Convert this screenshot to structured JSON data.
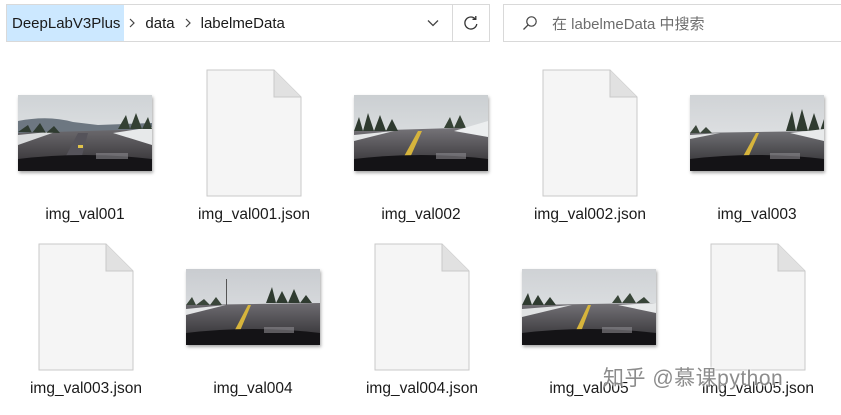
{
  "address": {
    "crumbs": [
      "DeepLabV3Plus",
      "data",
      "labelmeData"
    ]
  },
  "search": {
    "placeholder": "在 labelmeData 中搜索"
  },
  "files": [
    {
      "name": "img_val001",
      "kind": "image"
    },
    {
      "name": "img_val001.json",
      "kind": "json"
    },
    {
      "name": "img_val002",
      "kind": "image"
    },
    {
      "name": "img_val002.json",
      "kind": "json"
    },
    {
      "name": "img_val003",
      "kind": "image"
    },
    {
      "name": "img_val003.json",
      "kind": "json"
    },
    {
      "name": "img_val004",
      "kind": "image"
    },
    {
      "name": "img_val004.json",
      "kind": "json"
    },
    {
      "name": "img_val005",
      "kind": "image"
    },
    {
      "name": "img_val005.json",
      "kind": "json"
    }
  ],
  "icons": {
    "refresh": "refresh-icon",
    "search": "search-icon",
    "dropdown": "chevron-down-icon",
    "separator": "chevron-right-icon",
    "document": "file-document-icon"
  },
  "colors": {
    "selected_crumb": "#cce8ff",
    "border": "#d9d9d9"
  },
  "watermark": "知乎 @慕课python"
}
